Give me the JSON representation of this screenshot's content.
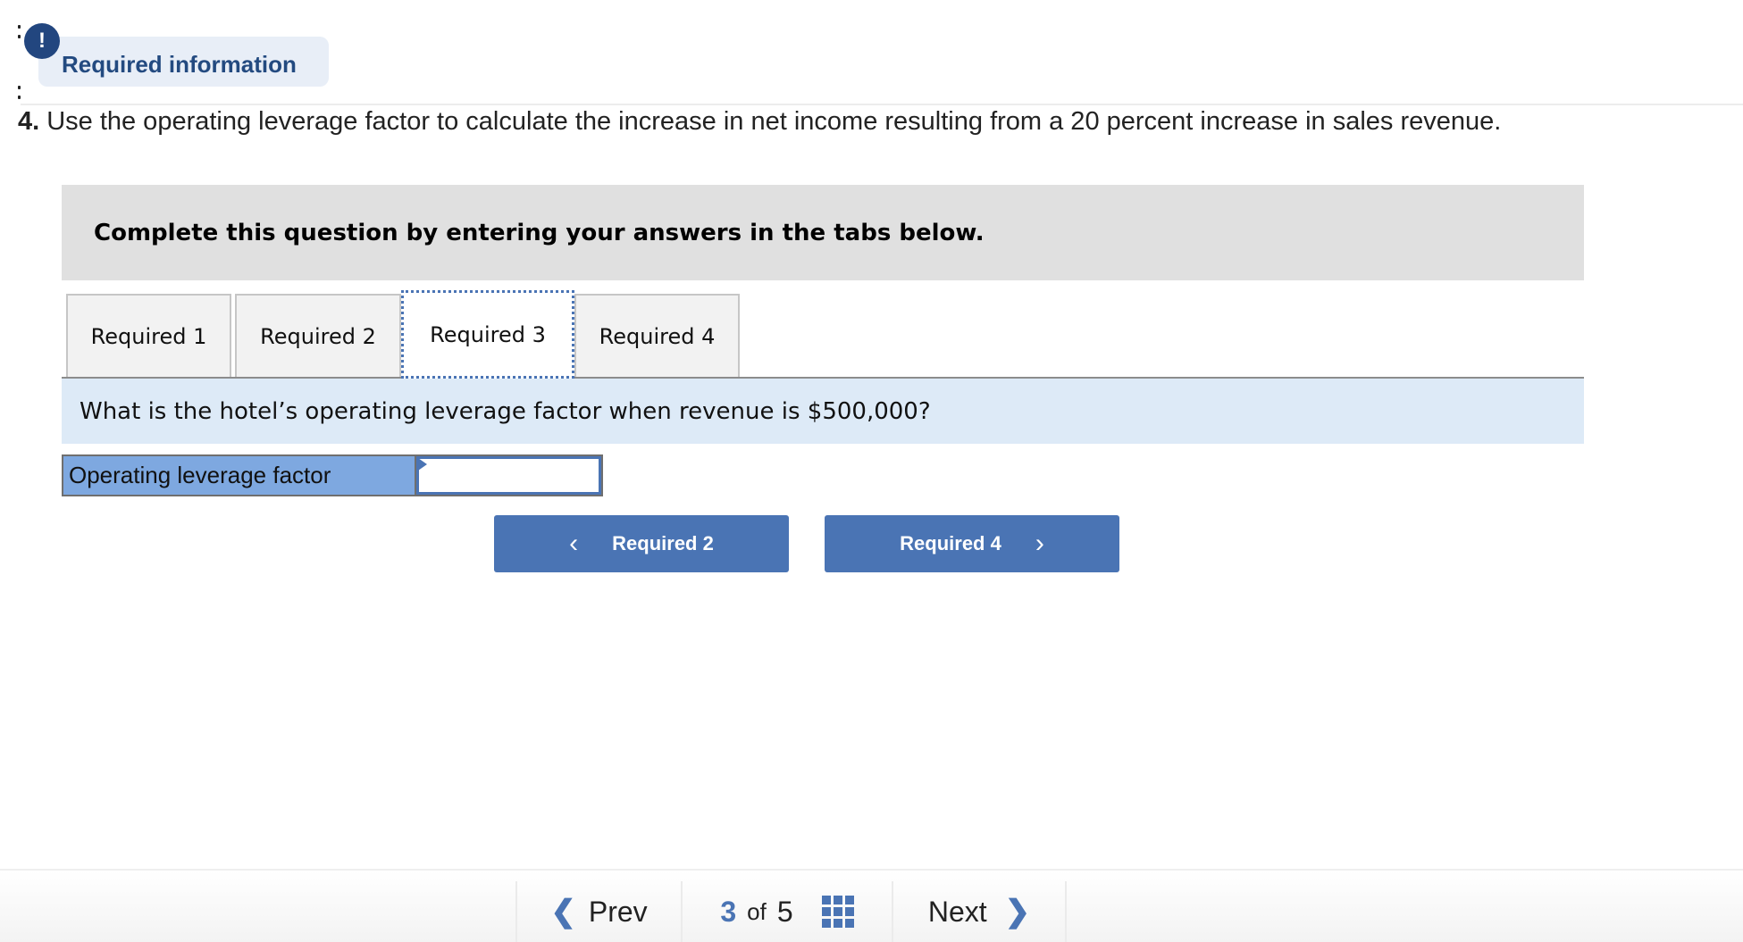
{
  "header": {
    "badge_icon": "exclamation-icon",
    "badge_glyph": "!",
    "required_info_label": "Required information"
  },
  "question": {
    "number": "4.",
    "text": "Use the operating leverage factor to calculate the increase in net income resulting from a 20 percent increase in sales revenue."
  },
  "instructions": "Complete this question by entering your answers in the tabs below.",
  "tabs": [
    {
      "label": "Required 1",
      "active": false
    },
    {
      "label": "Required 2",
      "active": false
    },
    {
      "label": "Required 3",
      "active": true
    },
    {
      "label": "Required 4",
      "active": false
    }
  ],
  "tab_content": {
    "prompt": "What is the hotel’s operating leverage factor when revenue is $500,000?",
    "answer_label": "Operating leverage factor",
    "answer_value": ""
  },
  "nav_buttons": {
    "prev_label": "Required 2",
    "prev_icon": "chevron-left-icon",
    "prev_glyph": "‹",
    "next_label": "Required 4",
    "next_icon": "chevron-right-icon",
    "next_glyph": "›"
  },
  "footer": {
    "prev_label": "Prev",
    "prev_glyph": "❮",
    "current_page": "3",
    "of_label": "of",
    "total_pages": "5",
    "grid_icon": "grid-icon",
    "next_label": "Next",
    "next_glyph": "❯"
  },
  "colors": {
    "accent": "#4a74b4",
    "badge": "#22467f",
    "pill_bg": "#e8eef7",
    "instructions_bg": "#e0e0e0",
    "prompt_bg": "#ddeaf7",
    "label_bg": "#7ea8e0"
  }
}
